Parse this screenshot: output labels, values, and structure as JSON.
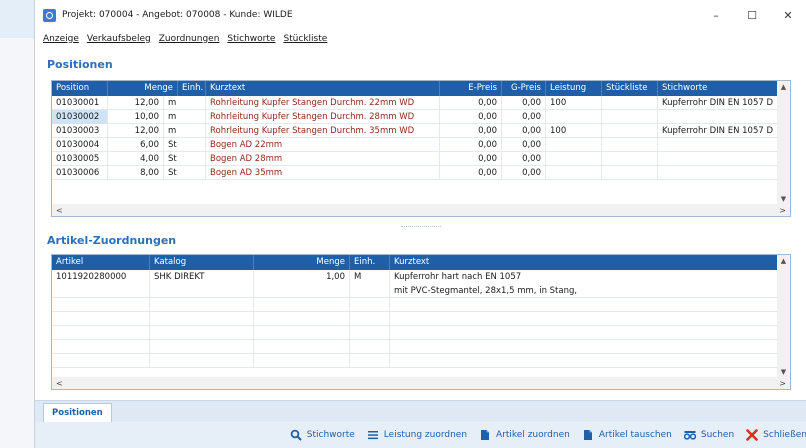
{
  "window": {
    "title": "Projekt: 070004 - Angebot: 070008 - Kunde: WILDE",
    "controls": {
      "minimize": "–",
      "maximize": "☐",
      "close": "✕"
    }
  },
  "menu": [
    "Anzeige",
    "Verkaufsbeleg",
    "Zuordnungen",
    "Stichworte",
    "Stückliste"
  ],
  "positionen": {
    "title": "Positionen",
    "columns": [
      "Position",
      "Menge",
      "Einh.",
      "Kurztext",
      "E-Preis",
      "G-Preis",
      "Leistung",
      "Stückliste",
      "Stichworte"
    ],
    "rows": [
      {
        "position": "01030001",
        "menge": "12,00",
        "einh": "m",
        "kurztext": "Rohrleitung Kupfer Stangen Durchm. 22mm WD",
        "epreis": "0,00",
        "gpreis": "0,00",
        "leistung": "100",
        "stueckliste": "",
        "stichworte": "Kupferrohr DIN EN 1057 D"
      },
      {
        "position": "01030002",
        "menge": "10,00",
        "einh": "m",
        "kurztext": "Rohrleitung Kupfer Stangen Durchm. 28mm WD",
        "epreis": "0,00",
        "gpreis": "0,00",
        "leistung": "",
        "stueckliste": "",
        "stichworte": ""
      },
      {
        "position": "01030003",
        "menge": "12,00",
        "einh": "m",
        "kurztext": "Rohrleitung Kupfer Stangen Durchm. 35mm WD",
        "epreis": "0,00",
        "gpreis": "0,00",
        "leistung": "100",
        "stueckliste": "",
        "stichworte": "Kupferrohr DIN EN 1057 D"
      },
      {
        "position": "01030004",
        "menge": "6,00",
        "einh": "St",
        "kurztext": "Bogen AD 22mm",
        "epreis": "0,00",
        "gpreis": "0,00",
        "leistung": "",
        "stueckliste": "",
        "stichworte": ""
      },
      {
        "position": "01030005",
        "menge": "4,00",
        "einh": "St",
        "kurztext": "Bogen AD 28mm",
        "epreis": "0,00",
        "gpreis": "0,00",
        "leistung": "",
        "stueckliste": "",
        "stichworte": ""
      },
      {
        "position": "01030006",
        "menge": "8,00",
        "einh": "St",
        "kurztext": "Bogen AD 35mm",
        "epreis": "0,00",
        "gpreis": "0,00",
        "leistung": "",
        "stueckliste": "",
        "stichworte": ""
      }
    ]
  },
  "artikel": {
    "title": "Artikel-Zuordnungen",
    "columns": [
      "Artikel",
      "Katalog",
      "Menge",
      "Einh.",
      "Kurztext"
    ],
    "rows": [
      {
        "artikel": "1011920280000",
        "katalog": "SHK DIREKT",
        "menge": "1,00",
        "einh": "M",
        "kurztext": "Kupferrohr hart nach EN 1057"
      },
      {
        "artikel": "",
        "katalog": "",
        "menge": "",
        "einh": "",
        "kurztext": "mit PVC-Stegmantel, 28x1,5 mm, in Stang,"
      }
    ]
  },
  "tabs": [
    "Positionen"
  ],
  "actions": [
    {
      "label": "Stichworte",
      "icon": "search-icon"
    },
    {
      "label": "Leistung zuordnen",
      "icon": "list-icon"
    },
    {
      "label": "Artikel zuordnen",
      "icon": "document-icon"
    },
    {
      "label": "Artikel tauschen",
      "icon": "document-icon"
    },
    {
      "label": "Suchen",
      "icon": "binoculars-icon"
    },
    {
      "label": "Schließen",
      "icon": "close-icon"
    }
  ],
  "colors": {
    "accent": "#1f5fa8",
    "header": "#1f5fa8",
    "selected": "#cfe3f7",
    "kurztext": "#8b2a1a",
    "close": "#d0341d"
  }
}
